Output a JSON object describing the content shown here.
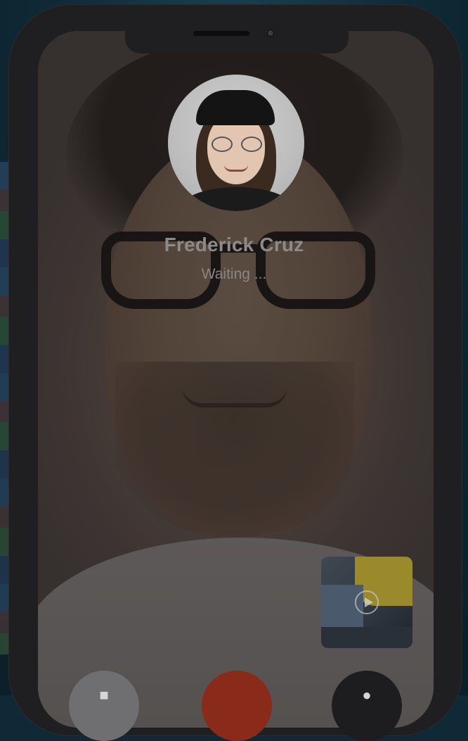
{
  "call": {
    "caller_name": "Frederick Cruz",
    "status": "Waiting ..."
  },
  "icons": {
    "speaker": "speaker-icon",
    "end_call": "end-call-icon",
    "mute": "microphone-icon",
    "play": "play-icon"
  },
  "colors": {
    "end_call": "#8a2a1a",
    "speaker_button": "#6f6f71",
    "mute_button": "#1d1d1f",
    "phone_frame": "#1f1f21",
    "background": "#0f2a36"
  }
}
